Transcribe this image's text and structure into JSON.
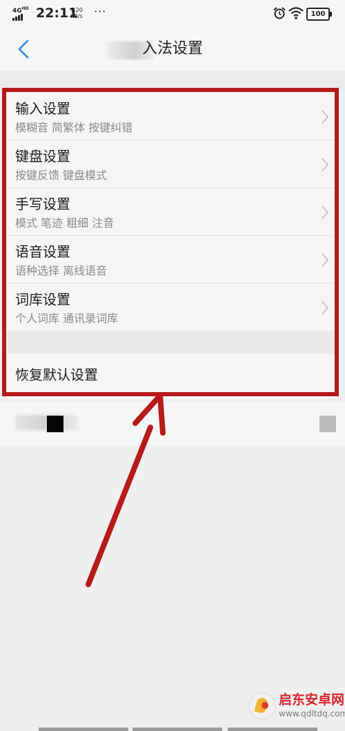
{
  "status_bar": {
    "network": "4G",
    "network_sup": "HD",
    "time": "22:11",
    "speed_value": "7.20",
    "speed_unit": "KB/s",
    "more": "···",
    "battery": "100"
  },
  "header": {
    "title": "入法设置",
    "back_icon": "chevron-left-icon"
  },
  "settings": [
    {
      "title": "输入设置",
      "subtitle": "模糊音 简繁体 按键纠错"
    },
    {
      "title": "键盘设置",
      "subtitle": "按键反馈 键盘模式"
    },
    {
      "title": "手写设置",
      "subtitle": "模式 笔迹 粗细 注音"
    },
    {
      "title": "语音设置",
      "subtitle": "语种选择 离线语音"
    },
    {
      "title": "词库设置",
      "subtitle": "个人词库 通讯录词库"
    }
  ],
  "reset_label": "恢复默认设置",
  "watermark": {
    "name": "启东安卓网",
    "url": "www.qdltdq.com"
  },
  "colors": {
    "highlight": "#b61a1a",
    "accent": "#3a8ee6",
    "background": "#efefef"
  }
}
